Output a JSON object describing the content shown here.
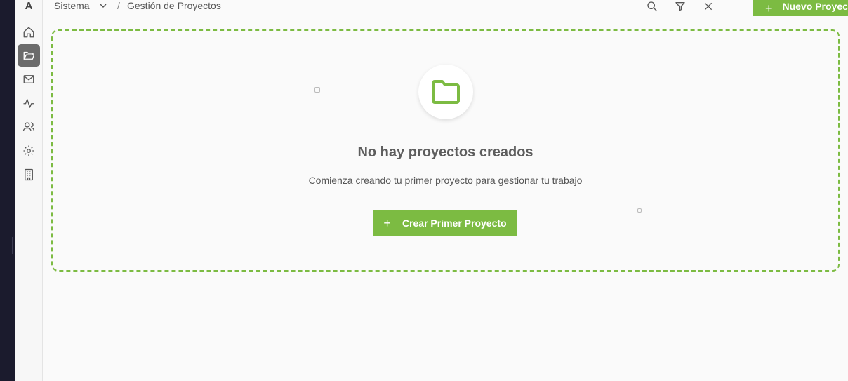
{
  "logo": "A",
  "breadcrumb": {
    "workspace": "Sistema",
    "separator": "/",
    "page": "Gestión de Proyectos"
  },
  "sidebar": {
    "items": [
      {
        "icon": "home-icon"
      },
      {
        "icon": "folder-icon",
        "active": true
      },
      {
        "icon": "mail-icon"
      },
      {
        "icon": "activity-icon"
      },
      {
        "icon": "users-icon"
      },
      {
        "icon": "settings-icon"
      },
      {
        "icon": "building-icon"
      }
    ]
  },
  "toolbar": {
    "icons": [
      "search-icon",
      "filter-icon",
      "close-icon"
    ],
    "new_project_label": "Nuevo Proyecto",
    "plus": "+"
  },
  "empty_state": {
    "icon": "folder-icon",
    "title": "No hay proyectos creados",
    "description": "Comienza creando tu primer proyecto para gestionar tu trabajo",
    "button_label": "Crear Primer Proyecto",
    "plus": "+"
  },
  "colors": {
    "accent": "#7cbb42",
    "active_nav": "#6b6b6b",
    "background": "#fafafa"
  }
}
